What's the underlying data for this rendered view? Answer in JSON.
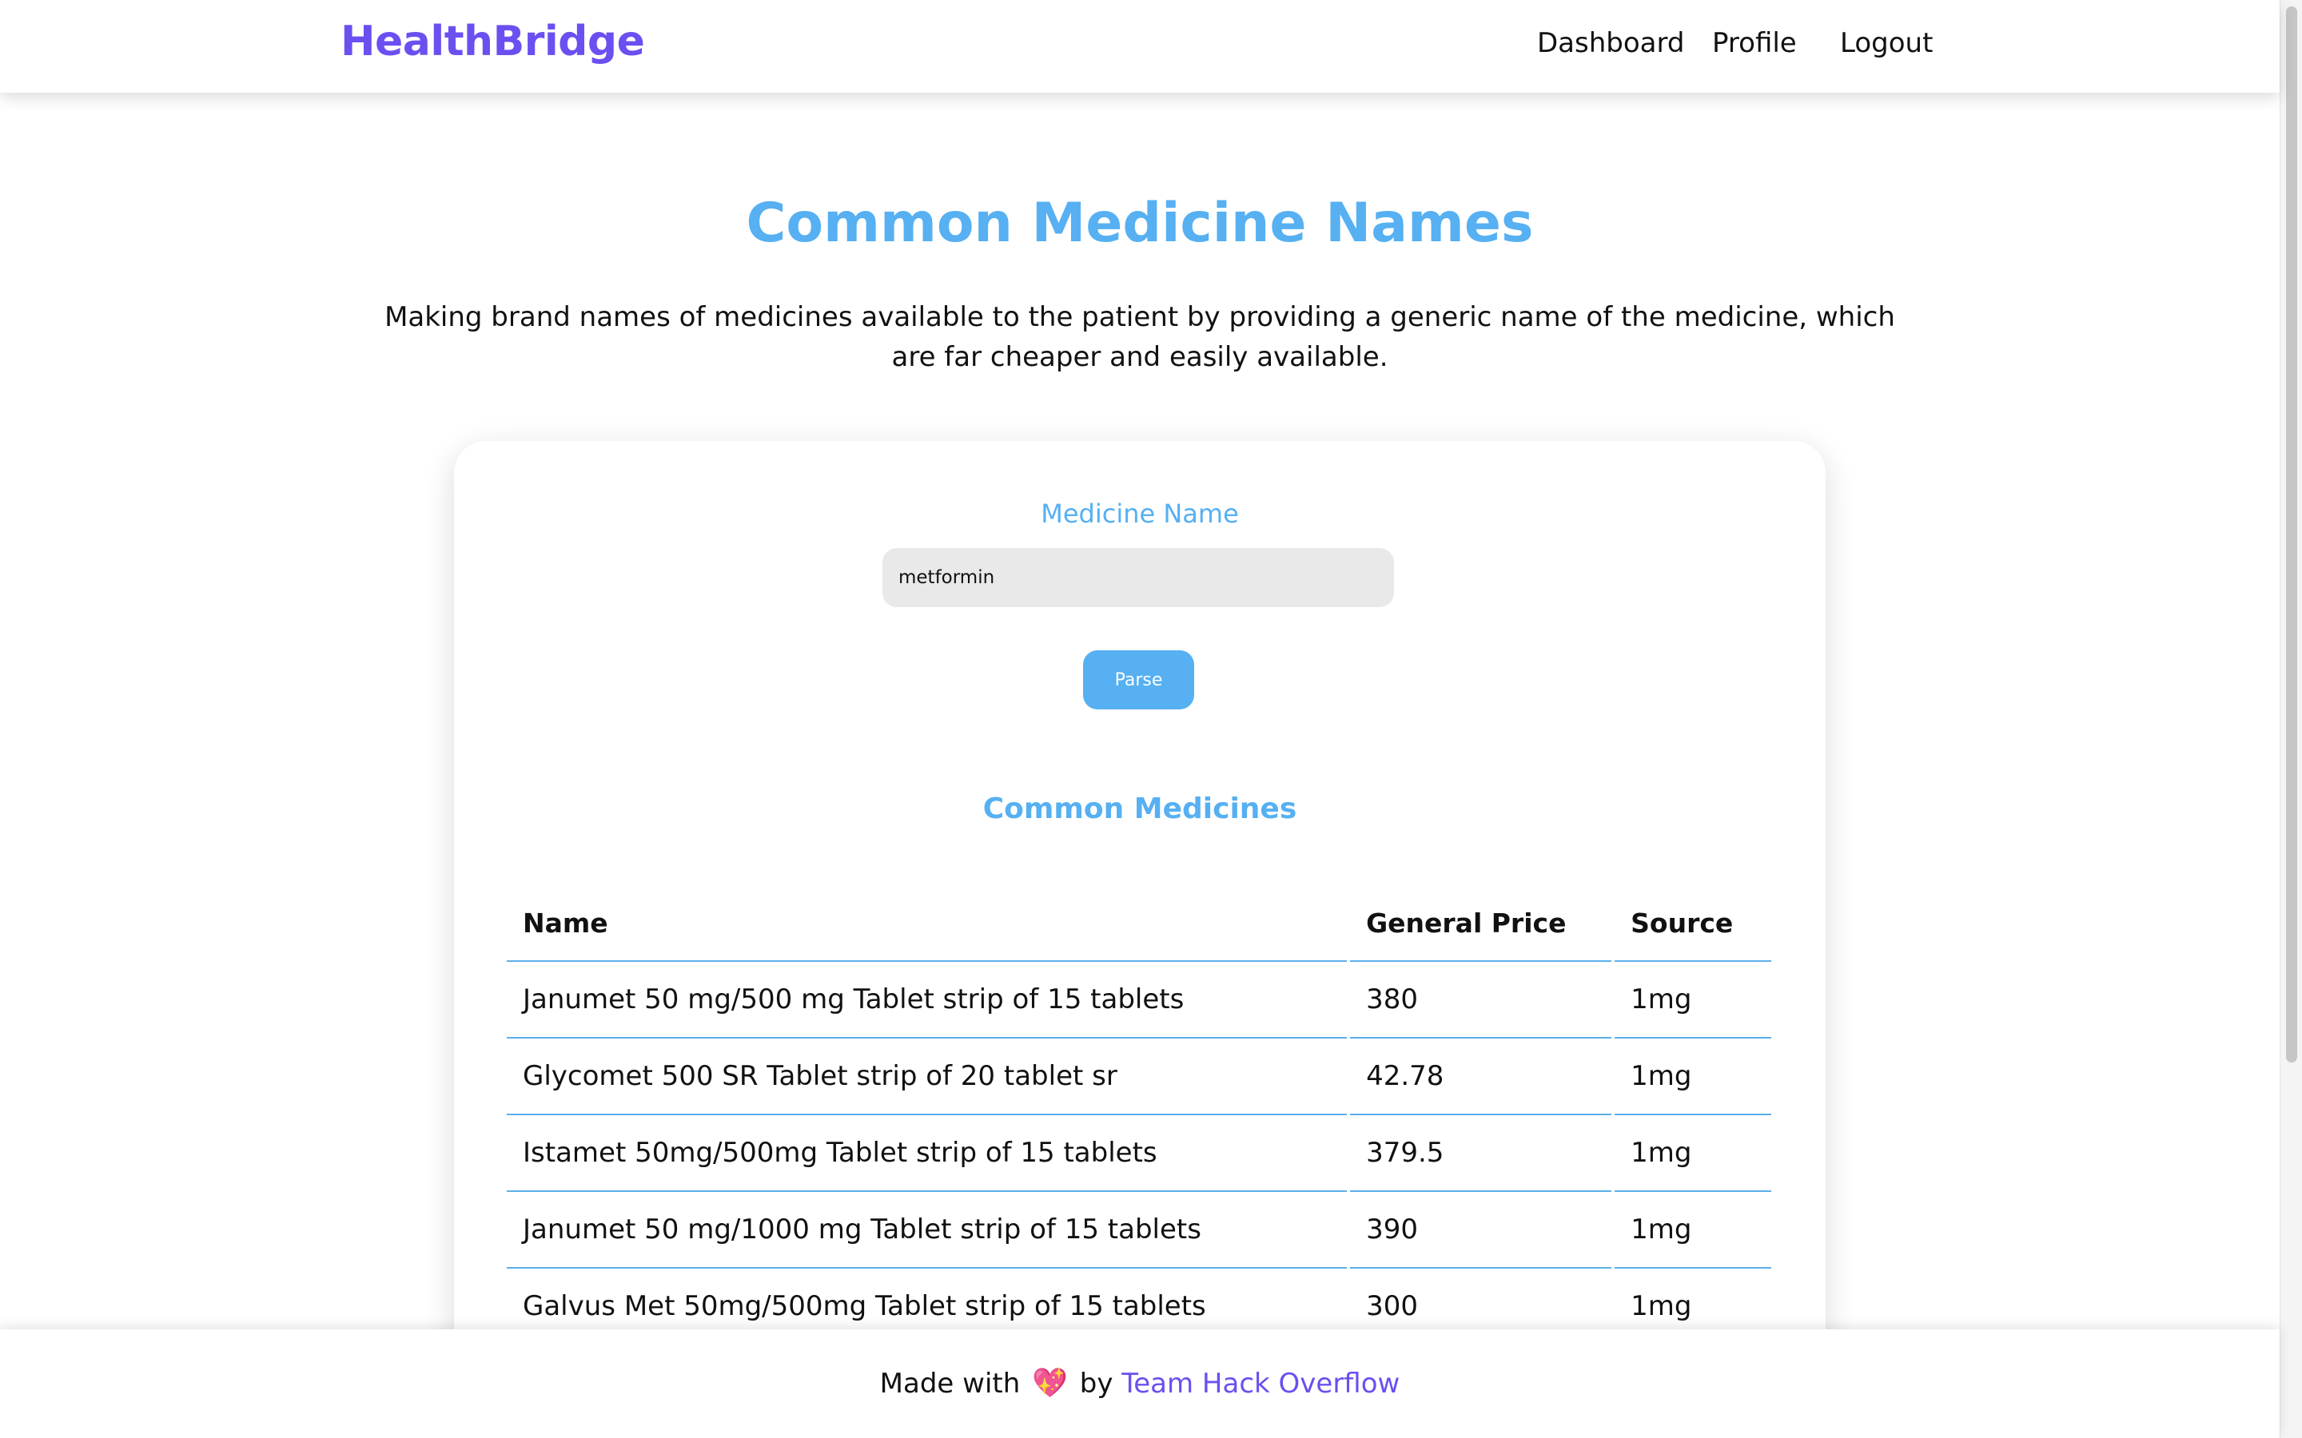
{
  "navbar": {
    "brand": "HealthBridge",
    "links": [
      "Dashboard",
      "Profile",
      "Logout"
    ]
  },
  "header": {
    "title": "Common Medicine Names",
    "intro": "Making brand names of medicines available to the patient by providing a generic name of the medicine, which are far cheaper and easily available."
  },
  "search": {
    "label": "Medicine Name",
    "value": "metformin",
    "button": "Parse"
  },
  "results": {
    "title": "Common Medicines",
    "columns": [
      "Name",
      "General Price",
      "Source"
    ],
    "rows": [
      {
        "name": "Janumet 50 mg/500 mg Tablet strip of 15 tablets",
        "price": "380",
        "source": "1mg"
      },
      {
        "name": "Glycomet 500 SR Tablet strip of 20 tablet sr",
        "price": "42.78",
        "source": "1mg"
      },
      {
        "name": "Istamet 50mg/500mg Tablet strip of 15 tablets",
        "price": "379.5",
        "source": "1mg"
      },
      {
        "name": "Janumet 50 mg/1000 mg Tablet strip of 15 tablets",
        "price": "390",
        "source": "1mg"
      },
      {
        "name": "Galvus Met 50mg/500mg Tablet strip of 15 tablets",
        "price": "300",
        "source": "1mg"
      }
    ]
  },
  "footer": {
    "prefix": "Made with",
    "heart": "💖",
    "by": "by",
    "team": "Team Hack Overflow"
  },
  "icons": {
    "heart": "heart-icon"
  },
  "colors": {
    "brand": "#6c4ff0",
    "accent": "#56b0f2"
  }
}
